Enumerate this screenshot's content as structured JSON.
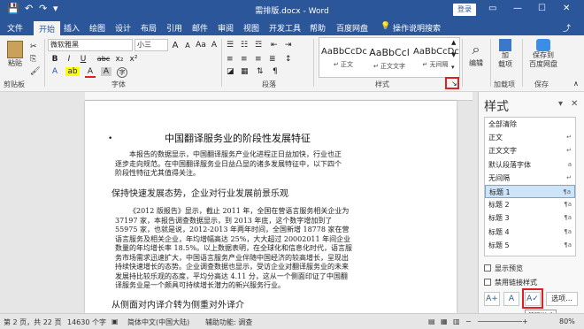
{
  "titlebar": {
    "save_icon": "💾",
    "undo": "↶",
    "redo": "↷",
    "customize": "▾",
    "title": "需排版.docx - Word",
    "login": "登录",
    "restore_icon": "▭",
    "min": "—",
    "max": "☐",
    "close": "✕"
  },
  "tabs": [
    "文件",
    "开始",
    "插入",
    "绘图",
    "设计",
    "布局",
    "引用",
    "邮件",
    "审阅",
    "视图",
    "开发工具",
    "帮助",
    "百度网盘"
  ],
  "tell_me": {
    "icon": "💡",
    "label": "操作说明搜索"
  },
  "share_icon": "⤴",
  "ribbon": {
    "paste_label": "粘贴",
    "clipboard_label": "剪贴板",
    "font_name": "微软雅黑",
    "font_size": "小三",
    "font_group_label": "字体",
    "grow": "A",
    "shrink": "A",
    "change_case": "Aa",
    "clear_fmt": "A",
    "bold": "B",
    "italic": "I",
    "underline": "U",
    "strike": "abc",
    "sub": "x₂",
    "sup": "x²",
    "text_effect": "A",
    "highlight": "ab",
    "font_color": "A",
    "char_shade": "A",
    "enclose": "字",
    "para_group_label": "段落",
    "styles": [
      {
        "sample": "AaBbCcDc",
        "name": "↵ 正文"
      },
      {
        "sample": "AaBbCcl",
        "name": "↵ 正文文字"
      },
      {
        "sample": "AaBbCcDc",
        "name": "↵ 无间隔"
      }
    ],
    "styles_label": "样式",
    "edit_label": "编辑",
    "edit_icon": "⌕",
    "addin_label": "加载项",
    "addin_btn": "加\n载项",
    "save_baidu": "保存到\n百度网盘",
    "save_label": "保存",
    "dialog_launcher": "↘"
  },
  "document": {
    "title": "中国翻译服务业的阶段性发展特征",
    "para1": "本报告的数据显示，中国翻译服务产业化进程正日益加快，行业也正逐步走向规范。在中国翻译服务业日益凸显的诸多发展特征中，以下四个阶段性特征尤其值得关注。",
    "heading1": "保持快速发展态势，企业对行业发展前景乐观",
    "para2": "《2012 版报告》显示，截止 2011 年，全国在营语言服务相关企业为 37197 家，本报告调查数据显示，到 2013 年底，这个数字增加到了 55975 家，也就是说，2012-2013 年两年时间，全国新增 18778 家在营语言服务及相关企业，年均增幅高达 25%，大大超过 20002011 年间企业数量的年均增长率 18.5%。以上数据表明，在全球化和信息化时代，语言服务市场需求迅速扩大，中国语言服务产业伴随中国经济的较高增长，呈现出持续快速增长的态势。企业调查数据也显示，受访企业对翻译服务业的未来发展持比较乐观的态度，平均分高达 4.11 分，这从一个侧面印证了中国翻译服务业是一个颇具可持续增长潜力的新兴服务行业。",
    "heading2": "从侧面对内译介转为侧重对外译介"
  },
  "pane": {
    "title": "样式",
    "options_icon": "▾",
    "close": "✕",
    "items": [
      {
        "name": "全部清除",
        "mark": ""
      },
      {
        "name": "正文",
        "mark": "↵"
      },
      {
        "name": "正文文字",
        "mark": "↵"
      },
      {
        "name": "默认段落字体",
        "mark": "a"
      },
      {
        "name": "无间隔",
        "mark": "↵"
      },
      {
        "name": "标题 1",
        "mark": "¶a"
      },
      {
        "name": "标题 2",
        "mark": "¶a"
      },
      {
        "name": "标题 3",
        "mark": "¶a"
      },
      {
        "name": "标题 4",
        "mark": "¶a"
      },
      {
        "name": "标题 5",
        "mark": "¶a"
      }
    ],
    "selected_index": 5,
    "show_preview": "显示预览",
    "disable_linked": "禁用链接样式",
    "new_style_icon": "A+",
    "inspector_icon": "A",
    "manage_icon": "A✓",
    "options_btn": "选项...",
    "tooltip": "管理样式"
  },
  "statusbar": {
    "page": "第 2 页，共 22 页",
    "words": "14630 个字",
    "track": "▣",
    "lang": "简体中文(中国大陆)",
    "accessibility": "辅助功能: 调查",
    "zoom": "80%",
    "view_read": "▤",
    "view_print": "▦",
    "view_web": "▥",
    "zoom_minus": "−",
    "zoom_plus": "+"
  },
  "colors": {
    "brand": "#2b579a",
    "highlight_red": "#e02020"
  }
}
